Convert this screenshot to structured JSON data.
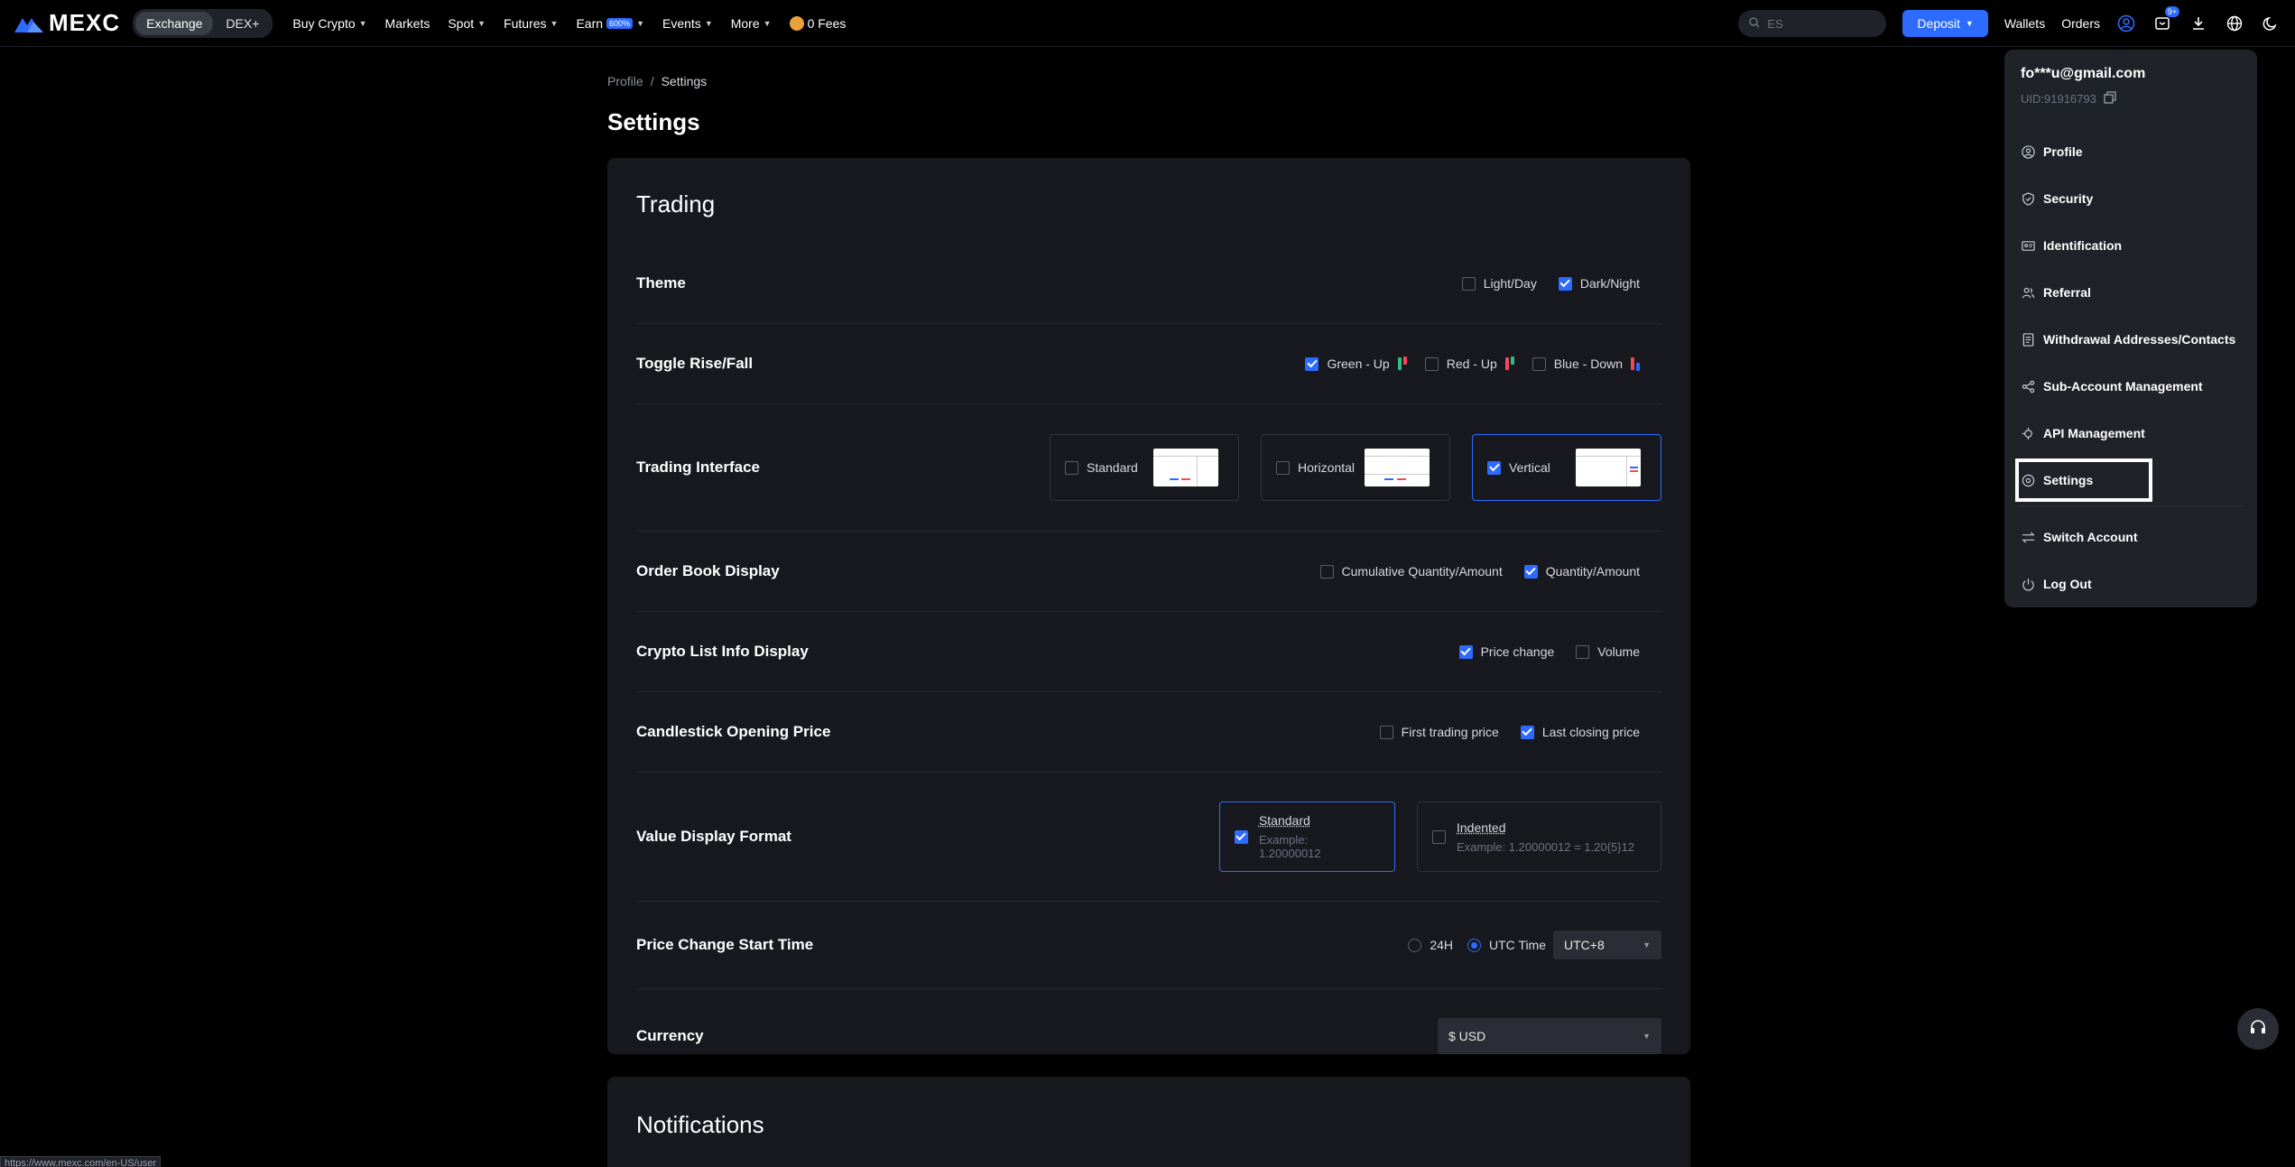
{
  "nav": {
    "logo": "MEXC",
    "segments": [
      "Exchange",
      "DEX+"
    ],
    "items": [
      {
        "label": "Buy Crypto",
        "caret": true
      },
      {
        "label": "Markets",
        "caret": false
      },
      {
        "label": "Spot",
        "caret": true
      },
      {
        "label": "Futures",
        "caret": true
      },
      {
        "label": "Earn",
        "badge": "600%",
        "caret": true
      },
      {
        "label": "Events",
        "caret": true
      },
      {
        "label": "More",
        "caret": true
      }
    ],
    "fees": "0 Fees",
    "search_placeholder": "ES",
    "deposit": "Deposit",
    "wallets": "Wallets",
    "orders": "Orders",
    "notif_count": "9+"
  },
  "breadcrumb": {
    "parent": "Profile",
    "sep": "/",
    "current": "Settings"
  },
  "page_title": "Settings",
  "trading": {
    "title": "Trading",
    "theme": {
      "label": "Theme",
      "options": [
        {
          "label": "Light/Day",
          "checked": false
        },
        {
          "label": "Dark/Night",
          "checked": true
        }
      ]
    },
    "rise_fall": {
      "label": "Toggle Rise/Fall",
      "options": [
        {
          "label": "Green - Up",
          "checked": true
        },
        {
          "label": "Red - Up",
          "checked": false
        },
        {
          "label": "Blue - Down",
          "checked": false
        }
      ]
    },
    "interface": {
      "label": "Trading Interface",
      "options": [
        {
          "label": "Standard",
          "checked": false
        },
        {
          "label": "Horizontal",
          "checked": false
        },
        {
          "label": "Vertical",
          "checked": true
        }
      ]
    },
    "order_book": {
      "label": "Order Book Display",
      "options": [
        {
          "label": "Cumulative Quantity/Amount",
          "checked": false
        },
        {
          "label": "Quantity/Amount",
          "checked": true
        }
      ]
    },
    "crypto_list": {
      "label": "Crypto List Info Display",
      "options": [
        {
          "label": "Price change",
          "checked": true
        },
        {
          "label": "Volume",
          "checked": false
        }
      ]
    },
    "candlestick": {
      "label": "Candlestick Opening Price",
      "options": [
        {
          "label": "First trading price",
          "checked": false
        },
        {
          "label": "Last closing price",
          "checked": true
        }
      ]
    },
    "value_format": {
      "label": "Value Display Format",
      "options": [
        {
          "label": "Standard",
          "example": "Example: 1.20000012",
          "checked": true
        },
        {
          "label": "Indented",
          "example": "Example: 1.20000012 = 1.20{5}12",
          "checked": false
        }
      ]
    },
    "price_change": {
      "label": "Price Change Start Time",
      "options": [
        {
          "label": "24H",
          "checked": false
        },
        {
          "label": "UTC Time",
          "checked": true
        }
      ],
      "timezone": "UTC+8"
    },
    "currency": {
      "label": "Currency",
      "value": "$ USD"
    }
  },
  "notifications": {
    "title": "Notifications"
  },
  "menu": {
    "email": "fo***u@gmail.com",
    "uid": "UID:91916793",
    "items": [
      "Profile",
      "Security",
      "Identification",
      "Referral",
      "Withdrawal Addresses/Contacts",
      "Sub-Account Management",
      "API Management",
      "Settings"
    ],
    "items2": [
      "Switch Account",
      "Log Out"
    ]
  },
  "status_url": "https://www.mexc.com/en-US/user",
  "colors": {
    "accent": "#2d6bff",
    "up": "#2ebd85",
    "down": "#f6465d"
  }
}
